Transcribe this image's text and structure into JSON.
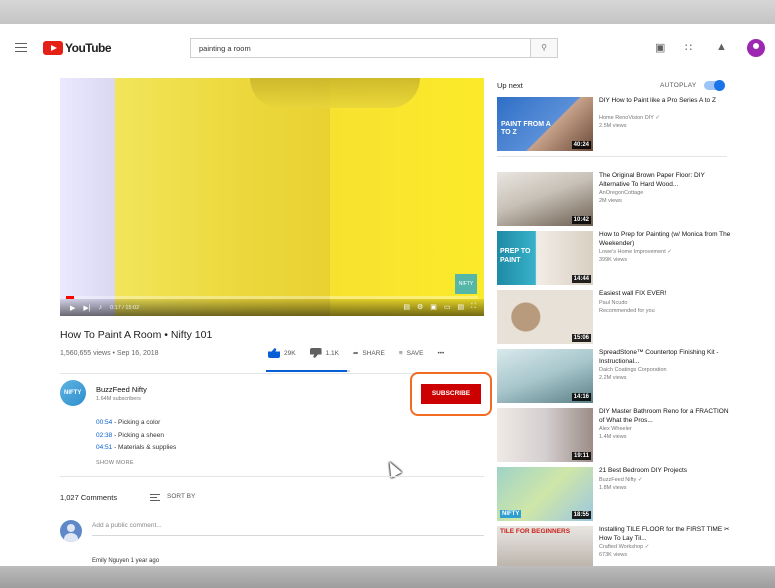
{
  "masthead": {
    "logo_text": "YouTube",
    "search_value": "painting a room",
    "search_icon": "search-icon",
    "icons": [
      "menu-icon",
      "video-camera-icon",
      "apps-grid-icon",
      "bell-icon",
      "account-avatar-icon"
    ]
  },
  "player": {
    "time": "0:17 / 15:02",
    "progress_fraction": 0.019,
    "watermark": "NIFTY"
  },
  "video": {
    "title": "How To Paint A Room • Nifty 101",
    "meta": "1,560,655 views • Sep 16, 2018",
    "likes": "29K",
    "dislikes": "1.1K",
    "share_label": "SHARE",
    "save_label": "SAVE",
    "more_label": "•••",
    "like_ratio": 0.96
  },
  "channel": {
    "name": "BuzzFeed Nifty",
    "subscribers": "1.64M subscribers",
    "avatar_text": "NIFTY",
    "subscribe_label": "SUBSCRIBE"
  },
  "chapters": [
    {
      "time": "00:54",
      "label": " - Picking a color"
    },
    {
      "time": "02:38",
      "label": " - Picking a sheen"
    },
    {
      "time": "04:51",
      "label": " - Materials & supplies"
    }
  ],
  "show_more": "SHOW MORE",
  "comments": {
    "count": "1,027 Comments",
    "sort_label": "SORT BY",
    "placeholder": "Add a public comment...",
    "next_author": "Emily Nguyen  1 year ago"
  },
  "sidebar": {
    "up_next": "Up next",
    "autoplay": "AUTOPLAY",
    "autoplay_on": true,
    "items": [
      {
        "title": "DIY How to Paint like a Pro Series A to Z",
        "channel": "Home RenoVision DIY ✓",
        "views": "2.5M views",
        "duration": "40:24",
        "thumb_text": "PAINT FROM A TO Z"
      },
      {
        "title": "The Original Brown Paper Floor: DIY Alternative To Hard Wood...",
        "channel": "AnOregonCottage",
        "views": "2M views",
        "duration": "10:42"
      },
      {
        "title": "How to Prep for Painting (w/ Monica from The Weekender)",
        "channel": "Lowe's Home Improvement ✓",
        "views": "399K views",
        "duration": "14:44",
        "thumb_text": "PREP TO PAINT"
      },
      {
        "title": "Easiest wall FIX EVER!",
        "channel": "Paul Ncudo",
        "views": "Recommended for you",
        "duration": "15:06"
      },
      {
        "title": "SpreadStone™ Countertop Finishing Kit - Instructional...",
        "channel": "Daich Coatings Corporation",
        "views": "2.2M views",
        "duration": "14:16"
      },
      {
        "title": "DIY Master Bathroom Reno for a FRACTION of What the Pros...",
        "channel": "Alex Wheeler",
        "views": "1.4M views",
        "duration": "19:11"
      },
      {
        "title": "21 Best Bedroom DIY Projects",
        "channel": "BuzzFeed Nifty ✓",
        "views": "1.8M views",
        "duration": "18:55",
        "thumb_text": "NIFTY"
      },
      {
        "title": "Installing TILE FLOOR for the FIRST TIME ✂ How To Lay Til...",
        "channel": "Crafted Workshop ✓",
        "views": "673K views",
        "thumb_text": "TILE FOR BEGINNERS"
      }
    ]
  }
}
